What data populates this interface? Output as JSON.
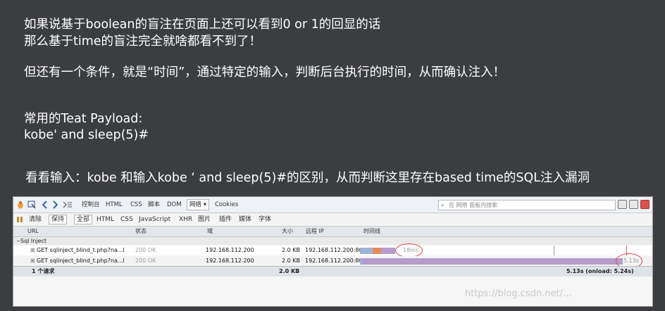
{
  "slide": {
    "line1": "如果说基于boolean的盲注在页面上还可以看到0 or 1的回显的话",
    "line2": "那么基于time的盲注完全就啥都看不到了！",
    "line3": "但还有一个条件，就是“时间”，通过特定的输入，判断后台执行的时间，从而确认注入！",
    "line4": "常用的Teat Payload:",
    "line5": "kobe' and sleep(5)#",
    "line6": "看看输入：kobe  和输入kobe ‘ and sleep(5)#的区别，从而判断这里存在based time的SQL注入漏洞"
  },
  "devtools": {
    "toolbar": {
      "console": "控制台",
      "html": "HTML",
      "css": "CSS",
      "script": "脚本",
      "dom": "DOM",
      "net": "网络",
      "net_arrow": "▾",
      "cookies": "Cookies",
      "search_placeholder": "在 网络 面板内搜索"
    },
    "filters": {
      "clear": "清除",
      "persist": "保持",
      "all": "全部",
      "html": "HTML",
      "css": "CSS",
      "js": "JavaScript",
      "xhr": "XHR",
      "images": "图片",
      "plugins": "插件",
      "media": "媒体",
      "fonts": "字体"
    },
    "columns": {
      "url": "URL",
      "status": "状态",
      "domain": "域",
      "size": "大小",
      "remote_ip": "远程 IP",
      "timeline": "时间线"
    },
    "group": "Sql Inject",
    "rows": [
      {
        "url": "GET sqlinject_blind_t.php?na...l",
        "status": "200 OK",
        "domain": "192.168.112.200",
        "size": "2.0 KB",
        "ip": "192.168.112.200:80",
        "time_label": "18ms"
      },
      {
        "url": "GET sqlinject_blind_t.php?na...l",
        "status": "200 OK",
        "domain": "192.168.112.200",
        "size": "2.0 KB",
        "ip": "192.168.112.200:80",
        "time_label": "5.13s"
      }
    ],
    "footer": {
      "requests": "1 个请求",
      "total_size": "2.0 KB",
      "total_time": "5.13s (onload: 5.24s)"
    },
    "colors": {
      "bar_blue": "#9fb4d8",
      "bar_orange": "#e58b5a",
      "bar_purple": "#b49ccd",
      "circle": "#d34a4a"
    }
  },
  "watermark": "https://blog.csdn.net/..."
}
